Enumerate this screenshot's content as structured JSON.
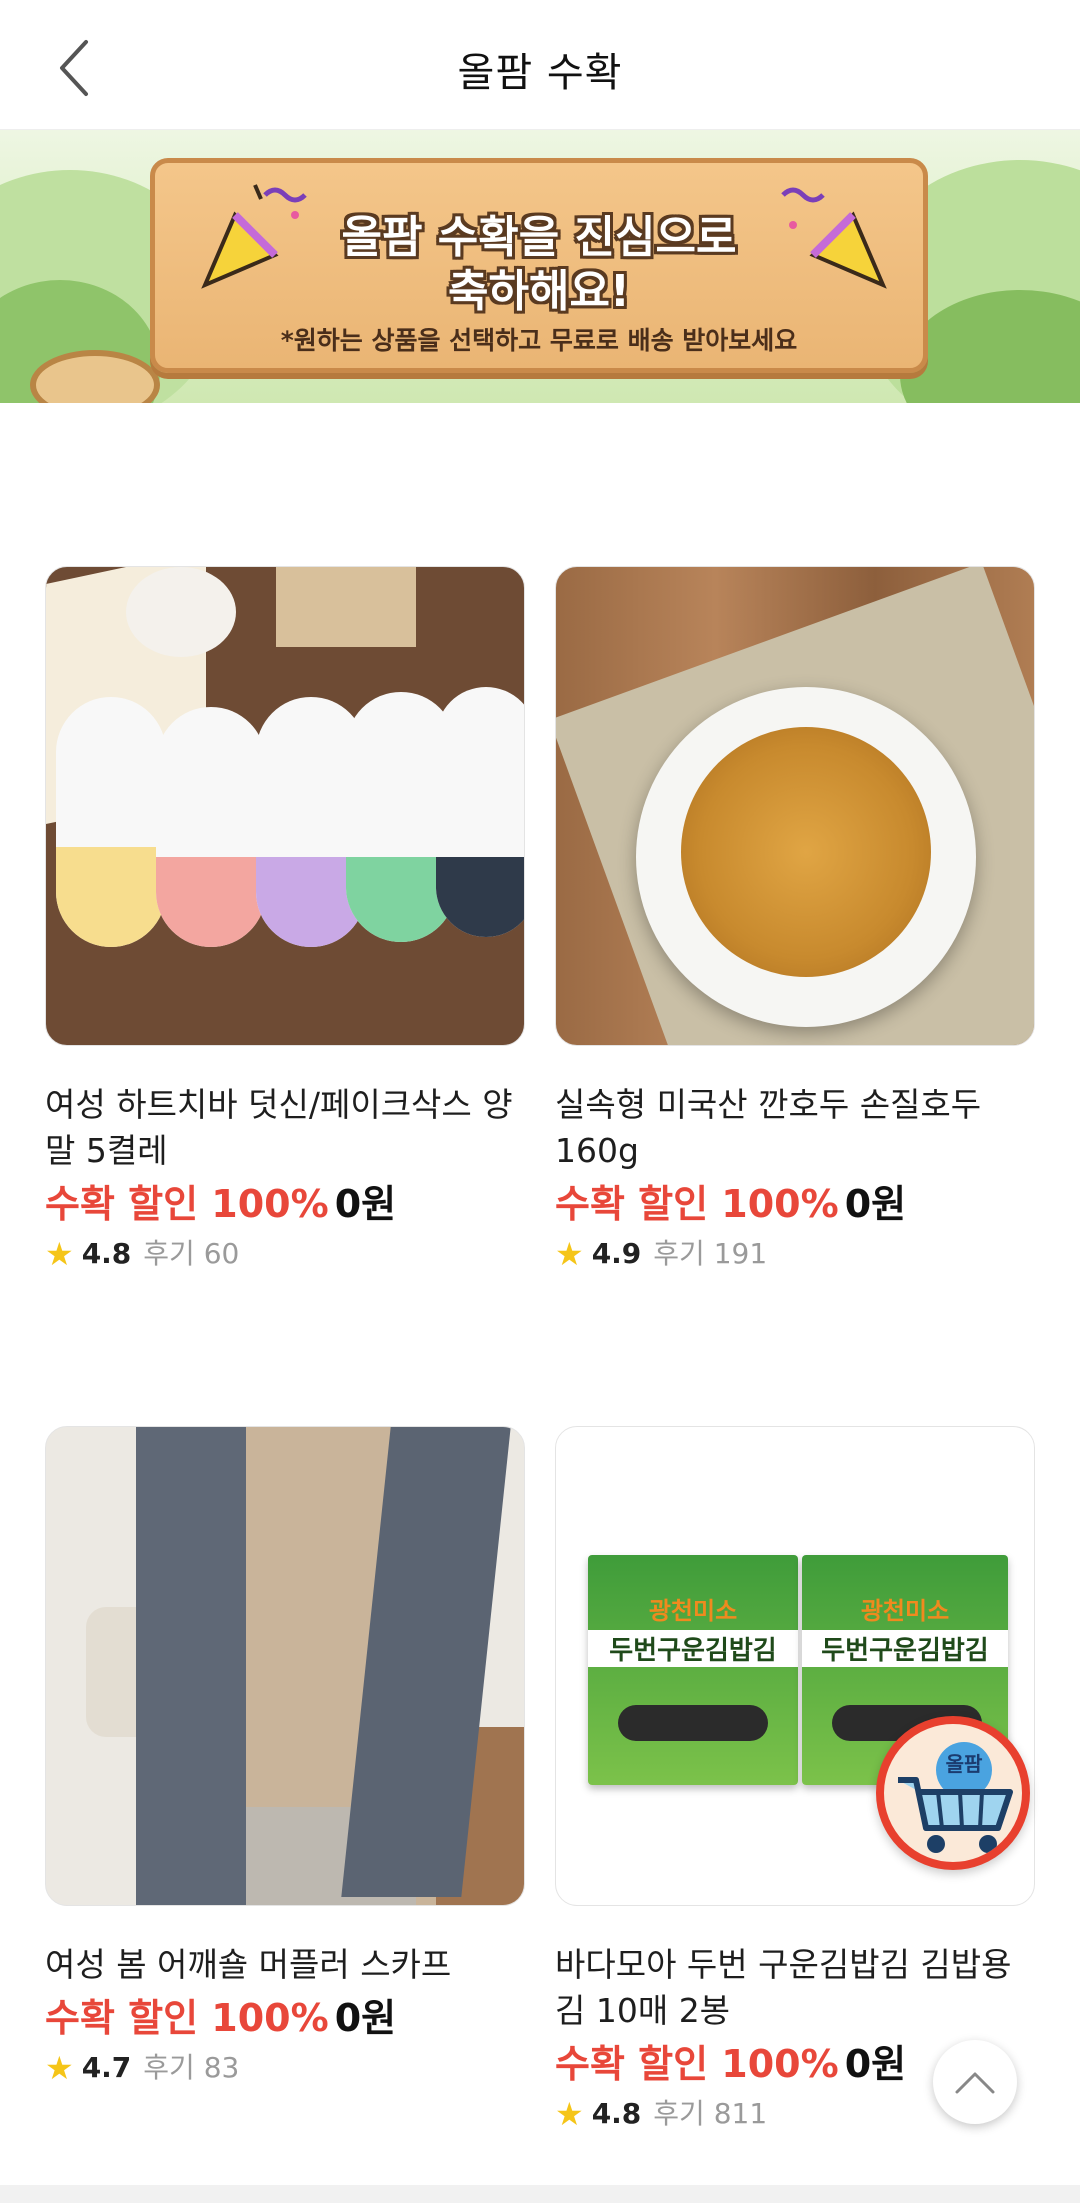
{
  "header": {
    "title": "올팜 수확"
  },
  "banner": {
    "headline_line1": "올팜 수확을 진심으로",
    "headline_line2": "축하해요!",
    "subtitle": "*원하는 상품을 선택하고 무료로 배송 받아보세요"
  },
  "products": [
    {
      "name": "여성 하트치바 덧신/페이크삭스 양말 5켤레",
      "discount_label": "수확 할인 100%",
      "price": "0원",
      "rating": "4.8",
      "reviews": "후기 60"
    },
    {
      "name": "실속형 미국산 깐호두 손질호두 160g",
      "discount_label": "수확 할인 100%",
      "price": "0원",
      "rating": "4.9",
      "reviews": "후기 191"
    },
    {
      "name": "여성 봄 어깨숄 머플러 스카프",
      "discount_label": "수확 할인 100%",
      "price": "0원",
      "rating": "4.7",
      "reviews": "후기 83"
    },
    {
      "name": "바다모아 두번 구운김밥김 김밥용김 10매 2봉",
      "discount_label": "수확 할인 100%",
      "price": "0원",
      "rating": "4.8",
      "reviews": "후기 811"
    }
  ],
  "product_images": {
    "p4_brand": "광천미소",
    "p4_title": "두번구운김밥김"
  },
  "fab": {
    "cart_label": "올팜"
  },
  "colors": {
    "discount": "#e8473a",
    "star": "#f5c518",
    "fab_border": "#e8402e"
  }
}
